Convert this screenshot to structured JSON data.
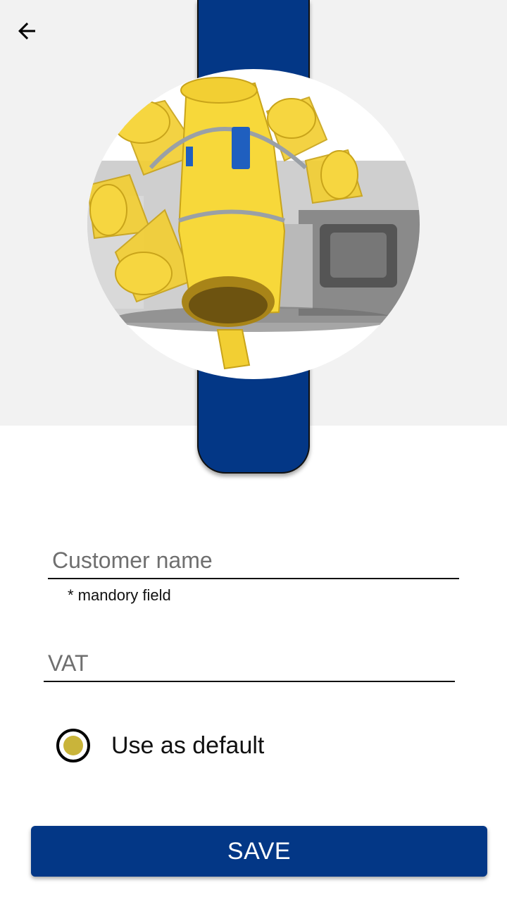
{
  "header": {
    "back_icon": "arrow-left-icon"
  },
  "hero": {
    "image": "yellow-cyclone-spreader-image",
    "strip_color": "#033786"
  },
  "form": {
    "customer_name": {
      "placeholder": "Customer name",
      "value": "",
      "helper": "* mandory field"
    },
    "vat": {
      "placeholder": "VAT",
      "value": ""
    },
    "default_option": {
      "label": "Use as default",
      "selected": true,
      "accent": "#c9b43a"
    }
  },
  "actions": {
    "save_label": "SAVE",
    "save_color": "#033786"
  }
}
